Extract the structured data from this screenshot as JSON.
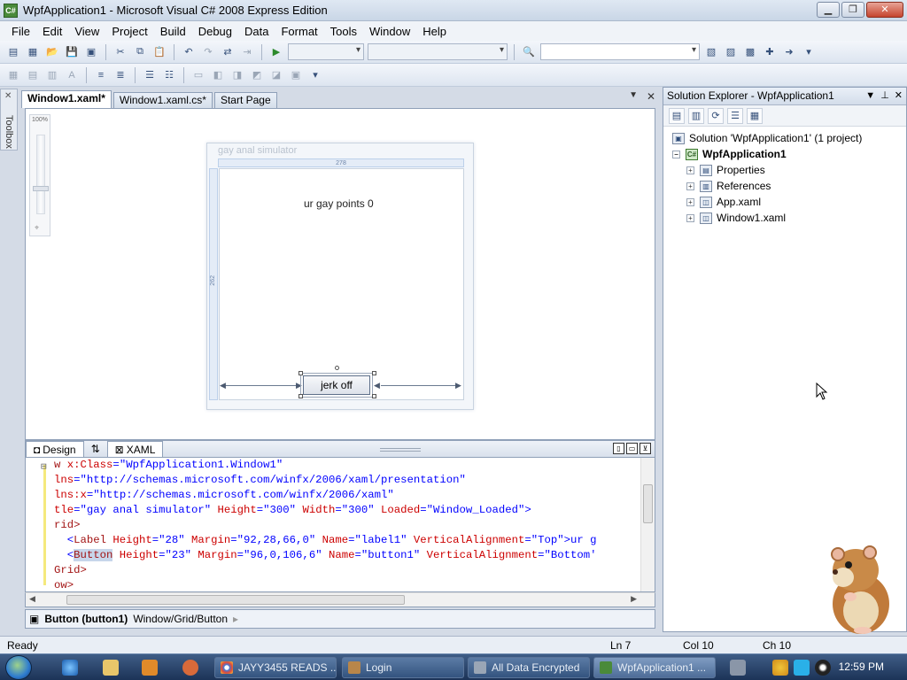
{
  "window": {
    "title": "WpfApplication1 - Microsoft Visual C# 2008 Express Edition",
    "controls": {
      "minimize": "▁",
      "maximize": "❐",
      "close": "✕"
    }
  },
  "menu": [
    "File",
    "Edit",
    "View",
    "Project",
    "Build",
    "Debug",
    "Data",
    "Format",
    "Tools",
    "Window",
    "Help"
  ],
  "doc_tabs": [
    "Window1.xaml*",
    "Window1.xaml.cs*",
    "Start Page"
  ],
  "toolbox_label": "Toolbox",
  "designer": {
    "zoom_label": "100%",
    "window_title": "gay anal simulator",
    "ruler_width": "278",
    "ruler_height": "262",
    "label_text": "ur gay points 0",
    "button_text": "jerk off"
  },
  "split_tabs": {
    "design": "Design",
    "swap": "⇅",
    "xaml": "XAML"
  },
  "xaml_lines": [
    [
      "w ",
      "x:Class",
      "=",
      "\"WpfApplication1.Window1\""
    ],
    [
      "lns",
      "=",
      "\"http://schemas.microsoft.com/winfx/2006/xaml/presentation\""
    ],
    [
      "lns:x",
      "=",
      "\"http://schemas.microsoft.com/winfx/2006/xaml\""
    ],
    [
      "tle",
      "=\"gay anal simulator\" ",
      "Height",
      "=\"300\" ",
      "Width",
      "=\"300\" ",
      "Loaded",
      "=\"Window_Loaded\">"
    ],
    [
      "rid>"
    ],
    [
      "  <",
      "Label",
      " Height",
      "=\"28\" ",
      "Margin",
      "=\"92,28,66,0\" ",
      "Name",
      "=\"label1\" ",
      "VerticalAlignment",
      "=\"Top\">ur g"
    ],
    [
      "  <",
      "Button",
      " Height",
      "=\"23\" ",
      "Margin",
      "=\"96,0,106,6\" ",
      "Name",
      "=\"button1\" ",
      "VerticalAlignment",
      "=\"Bottom'"
    ],
    [
      "Grid>"
    ],
    [
      "ow>"
    ]
  ],
  "breadcrumb": {
    "element": "Button (button1)",
    "path": "Window/Grid/Button"
  },
  "solution_explorer": {
    "title": "Solution Explorer - WpfApplication1",
    "items": [
      {
        "label": "Solution 'WpfApplication1' (1 project)",
        "bold": false
      },
      {
        "label": "WpfApplication1",
        "bold": true
      },
      {
        "label": "Properties",
        "bold": false
      },
      {
        "label": "References",
        "bold": false
      },
      {
        "label": "App.xaml",
        "bold": false
      },
      {
        "label": "Window1.xaml",
        "bold": false
      }
    ]
  },
  "status": {
    "ready": "Ready",
    "ln": "Ln 7",
    "col": "Col 10",
    "ch": "Ch 10"
  },
  "taskbar": {
    "buttons": [
      "JAYY3455 READS ...",
      "Login",
      "All Data Encrypted",
      "WpfApplication1 ..."
    ],
    "clock": "12:59 PM"
  },
  "colors": {
    "xaml_keyword": "#0000ff",
    "xaml_attr": "#cc0000",
    "xaml_value": "#a31515"
  }
}
